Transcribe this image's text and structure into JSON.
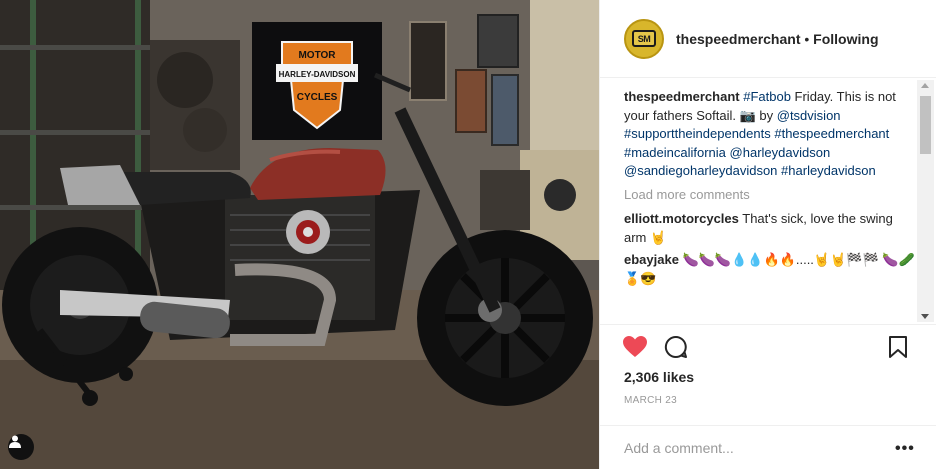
{
  "post": {
    "image_alt": "Custom Harley-Davidson Fatbob motorcycle in a workshop",
    "banner_text_top": "MOTOR",
    "banner_text_mid": "HARLEY-DAVIDSON",
    "banner_text_bottom": "CYCLES"
  },
  "header": {
    "username": "thespeedmerchant",
    "separator": " • ",
    "follow_state": "Following",
    "avatar_text": "SM"
  },
  "caption": {
    "username": "thespeedmerchant",
    "parts": {
      "hashtag_fatbob": "#Fatbob",
      "text1": " Friday. This is not your fathers Softail. 📷 by ",
      "mention_tsdvision": "@tsdvision",
      "hashtag_support": "#supporttheindependents",
      "hashtag_speedmerchant": "#thespeedmerchant",
      "hashtag_madeincalifornia": "#madeincalifornia",
      "mention_harleydavidson": "@harleydavidson",
      "mention_sandiego": "@sandiegoharleydavidson",
      "hashtag_harleydavidson": "#harleydavidson"
    }
  },
  "load_more": "Load more comments",
  "comments": [
    {
      "username": "elliott.motorcycles",
      "text": " That's sick, love the swing arm 🤘"
    },
    {
      "username": "ebayjake",
      "text": " 🍆🍆🍆💧💧🔥🔥.....🤘🤘🏁🏁 🍆🥒🏅😎"
    }
  ],
  "actions": {
    "likes": "2,306 likes",
    "date": "MARCH 23"
  },
  "comment_input": {
    "placeholder": "Add a comment...",
    "more_label": "•••"
  },
  "colors": {
    "like_red": "#ed4956",
    "link_blue": "#003569",
    "muted_gray": "#999999"
  },
  "icons": [
    "heart-icon",
    "comment-icon",
    "bookmark-icon",
    "user-tag-icon",
    "more-options-icon"
  ]
}
